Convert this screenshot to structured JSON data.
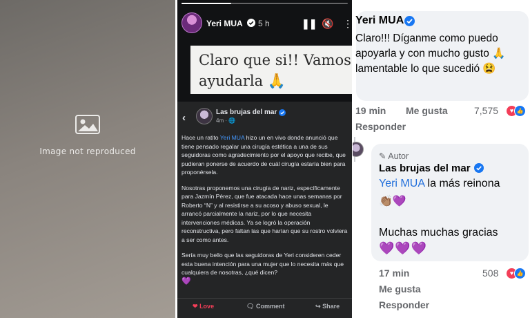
{
  "photo_panel": {
    "placeholder_label": "Image not reproduced"
  },
  "story": {
    "author": "Yeri MUA",
    "time_ago": "5 h",
    "progress": 0.3,
    "controls": {
      "pause_icon": "pause-icon",
      "mute_icon": "mute-icon",
      "more_icon": "more-icon"
    },
    "caption_lines": [
      "Claro que si!! Vamos a",
      "ayudarla 🙏"
    ]
  },
  "post": {
    "page_name": "Las brujas del mar",
    "meta": "4m · 🌐",
    "paragraph1_pre": "Hace un ratito ",
    "paragraph1_mention": "Yeri MUA",
    "paragraph1_post": " hizo un en vivo donde anunció que tiene pensado regalar una cirugía estética a una de sus seguidoras como agradecimiento por el apoyo que recibe, que pudieran ponerse de acuerdo de cuál cirugía estaría bien para proponérsela.",
    "paragraph2": "Nosotras proponemos una cirugía de nariz, específicamente para Jazmín Pérez, que fue atacada hace unas semanas por Roberto “N” y al resistirse a su acoso y abuso sexual, le arrancó parcialmente la nariz, por lo que necesita intervenciones médicas. Ya se logró la operación reconstructiva, pero faltan las que harían que su rostro volviera a ser como antes.",
    "paragraph3": "Sería muy bello que las seguidoras de Yeri consideren ceder esta buena intención para una mujer que lo necesita más que cualquiera de nosotras, ¿qué dicen?",
    "paragraph3_heart": "💜",
    "actions": {
      "love": "Love",
      "comment": "Comment",
      "share": "Share"
    }
  },
  "comment1": {
    "author": "Yeri MUA",
    "text": "Claro!!! Díganme como puedo apoyarla y con mucho gusto 🙏 lamentable lo que sucedió 😫",
    "time": "19 min",
    "like": "Me gusta",
    "reaction_count": "7,575",
    "reply": "Responder"
  },
  "comment2": {
    "badge": "Autor",
    "author": "Las brujas del mar",
    "mention": "Yeri MUA",
    "text1": " la más reinona",
    "emojis": "👏🏽💜",
    "text2": "Muchas muchas gracias",
    "hearts": "💜💜💜",
    "time": "17 min",
    "reaction_count": "508",
    "like": "Me gusta",
    "reply": "Responder"
  },
  "colors": {
    "facebook_blue": "#1877f2",
    "love_red": "#f33e58",
    "mention_blue": "#216fdb",
    "story_bg": "#111214",
    "post_bg": "#242526"
  }
}
